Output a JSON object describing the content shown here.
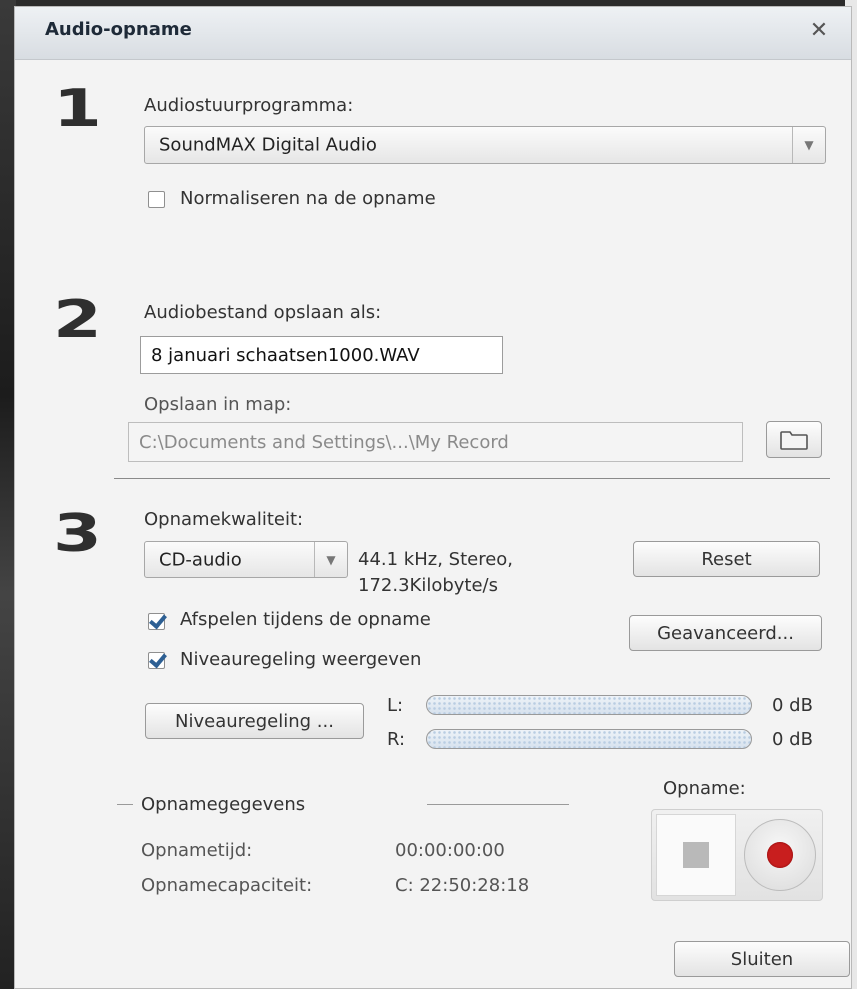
{
  "window": {
    "title": "Audio-opname",
    "close_glyph": "✕"
  },
  "step1": {
    "number": "1",
    "label": "Audiostuurprogramma:",
    "driver_value": "SoundMAX Digital Audio",
    "normalize_label": "Normaliseren na de opname",
    "normalize_checked": false
  },
  "step2": {
    "number": "2",
    "save_as_label": "Audiobestand opslaan als:",
    "filename_value": "8 januari schaatsen1000.WAV",
    "folder_label": "Opslaan in map:",
    "folder_value": "C:\\Documents and Settings\\...\\My Record"
  },
  "step3": {
    "number": "3",
    "quality_label": "Opnamekwaliteit:",
    "quality_value": "CD-audio",
    "quality_info_line1": "44.1 kHz, Stereo,",
    "quality_info_line2": "172.3Kilobyte/s",
    "reset_label": "Reset",
    "play_during_label": "Afspelen tijdens de opname",
    "play_during_checked": true,
    "advanced_label": "Geavanceerd...",
    "show_level_label": "Niveauregeling weergeven",
    "show_level_checked": true,
    "level_button_label": "Niveauregeling ...",
    "left_channel": {
      "label": "L:",
      "value": "0 dB"
    },
    "right_channel": {
      "label": "R:",
      "value": "0 dB"
    }
  },
  "recording": {
    "section_label": "Opnamegegevens",
    "time_label": "Opnametijd:",
    "time_value": "00:00:00:00",
    "capacity_label": "Opnamecapaciteit:",
    "capacity_value": "C: 22:50:28:18",
    "record_label": "Opname:"
  },
  "footer": {
    "close_label": "Sluiten"
  },
  "colors": {
    "record_dot": "#c81e1e",
    "check_mark": "#2d5f93",
    "title_text": "#1e2a38"
  },
  "icons": [
    "close-icon",
    "dropdown-arrow-icon",
    "folder-icon",
    "stop-icon",
    "record-icon",
    "checkmark-icon"
  ]
}
